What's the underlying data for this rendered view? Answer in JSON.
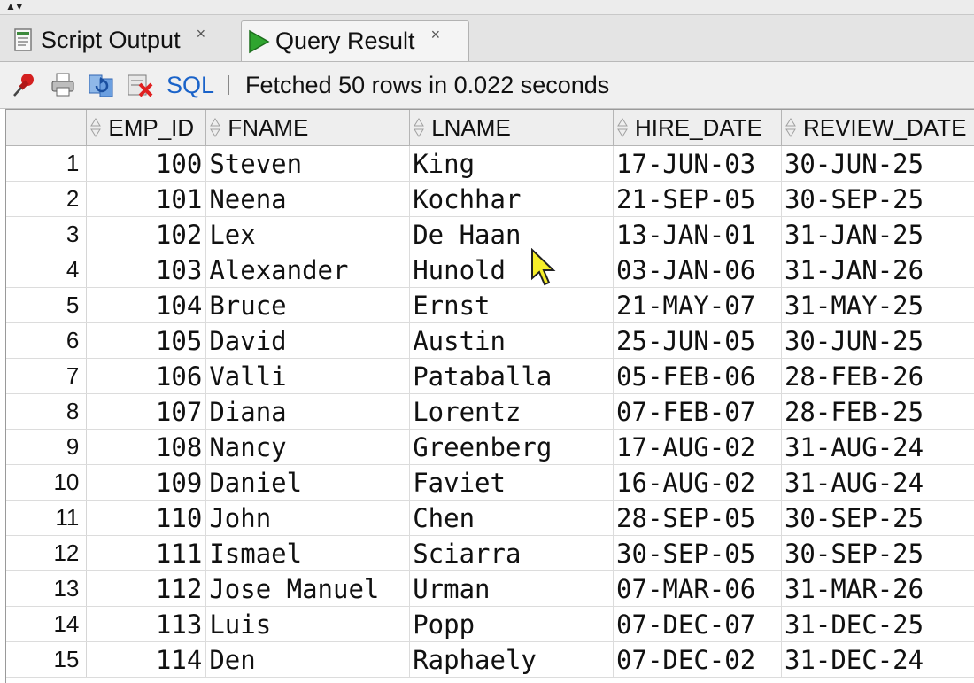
{
  "tabs": [
    {
      "label": "Script Output",
      "close": "×",
      "icon": "script-output-icon"
    },
    {
      "label": "Query Result",
      "close": "×",
      "icon": "run-query-icon",
      "active": true
    }
  ],
  "toolbar": {
    "icons": [
      "pin-icon",
      "print-icon",
      "refresh-icon",
      "clear-icon"
    ],
    "sql_label": "SQL",
    "status": "Fetched 50 rows in 0.022 seconds"
  },
  "grid": {
    "columns": [
      "EMP_ID",
      "FNAME",
      "LNAME",
      "HIRE_DATE",
      "REVIEW_DATE"
    ],
    "rows": [
      {
        "n": "1",
        "emp_id": "100",
        "fname": "Steven",
        "lname": "King",
        "hire_date": "17-JUN-03",
        "review_date": "30-JUN-25"
      },
      {
        "n": "2",
        "emp_id": "101",
        "fname": "Neena",
        "lname": "Kochhar",
        "hire_date": "21-SEP-05",
        "review_date": "30-SEP-25"
      },
      {
        "n": "3",
        "emp_id": "102",
        "fname": "Lex",
        "lname": "De Haan",
        "hire_date": "13-JAN-01",
        "review_date": "31-JAN-25"
      },
      {
        "n": "4",
        "emp_id": "103",
        "fname": "Alexander",
        "lname": "Hunold",
        "hire_date": "03-JAN-06",
        "review_date": "31-JAN-26"
      },
      {
        "n": "5",
        "emp_id": "104",
        "fname": "Bruce",
        "lname": "Ernst",
        "hire_date": "21-MAY-07",
        "review_date": "31-MAY-25"
      },
      {
        "n": "6",
        "emp_id": "105",
        "fname": "David",
        "lname": "Austin",
        "hire_date": "25-JUN-05",
        "review_date": "30-JUN-25"
      },
      {
        "n": "7",
        "emp_id": "106",
        "fname": "Valli",
        "lname": "Pataballa",
        "hire_date": "05-FEB-06",
        "review_date": "28-FEB-26"
      },
      {
        "n": "8",
        "emp_id": "107",
        "fname": "Diana",
        "lname": "Lorentz",
        "hire_date": "07-FEB-07",
        "review_date": "28-FEB-25"
      },
      {
        "n": "9",
        "emp_id": "108",
        "fname": "Nancy",
        "lname": "Greenberg",
        "hire_date": "17-AUG-02",
        "review_date": "31-AUG-24"
      },
      {
        "n": "10",
        "emp_id": "109",
        "fname": "Daniel",
        "lname": "Faviet",
        "hire_date": "16-AUG-02",
        "review_date": "31-AUG-24"
      },
      {
        "n": "11",
        "emp_id": "110",
        "fname": "John",
        "lname": "Chen",
        "hire_date": "28-SEP-05",
        "review_date": "30-SEP-25"
      },
      {
        "n": "12",
        "emp_id": "111",
        "fname": "Ismael",
        "lname": "Sciarra",
        "hire_date": "30-SEP-05",
        "review_date": "30-SEP-25"
      },
      {
        "n": "13",
        "emp_id": "112",
        "fname": "Jose Manuel",
        "lname": "Urman",
        "hire_date": "07-MAR-06",
        "review_date": "31-MAR-26"
      },
      {
        "n": "14",
        "emp_id": "113",
        "fname": "Luis",
        "lname": "Popp",
        "hire_date": "07-DEC-07",
        "review_date": "31-DEC-25"
      },
      {
        "n": "15",
        "emp_id": "114",
        "fname": "Den",
        "lname": "Raphaely",
        "hire_date": "07-DEC-02",
        "review_date": "31-DEC-24"
      }
    ]
  }
}
